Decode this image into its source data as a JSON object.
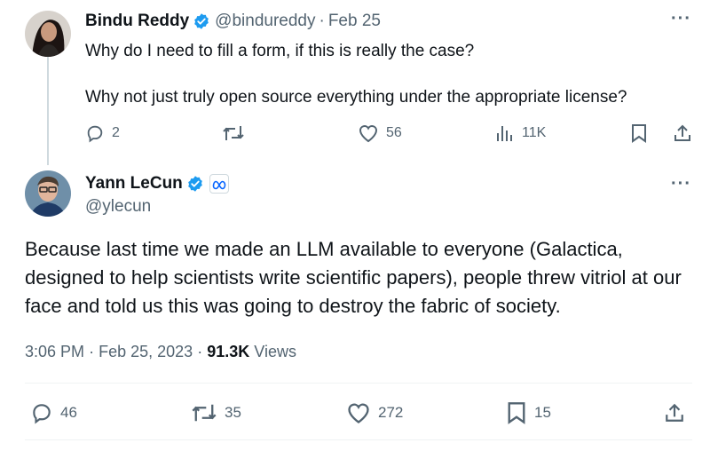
{
  "reply_tweet": {
    "author_name": "Bindu Reddy",
    "handle": "@bindureddy",
    "separator": "·",
    "date": "Feb 25",
    "text_paragraphs": [
      "Why do I need to fill a form, if this is really the case?",
      "Why not just truly open source everything under the appropriate license?"
    ],
    "more_label": "···",
    "actions": {
      "replies": "2",
      "retweets": "",
      "likes": "56",
      "views": "11K"
    }
  },
  "main_tweet": {
    "author_name": "Yann LeCun",
    "handle": "@ylecun",
    "affiliation_icon": "meta-logo-icon",
    "more_label": "···",
    "text": "Because last time we made an LLM available to everyone (Galactica, designed to help scientists write scientific papers), people threw vitriol at our face and told us this was going to destroy the fabric of society.",
    "time": "3:06 PM",
    "separator": "·",
    "date": "Feb 25, 2023",
    "views_count": "91.3K",
    "views_label": "Views",
    "actions": {
      "replies": "46",
      "retweets": "35",
      "likes": "272",
      "bookmarks": "15"
    }
  },
  "colors": {
    "verified_blue": "#1d9bf0",
    "secondary_text": "#536471",
    "primary_text": "#0f1419",
    "thread_line": "#cfd9de"
  }
}
